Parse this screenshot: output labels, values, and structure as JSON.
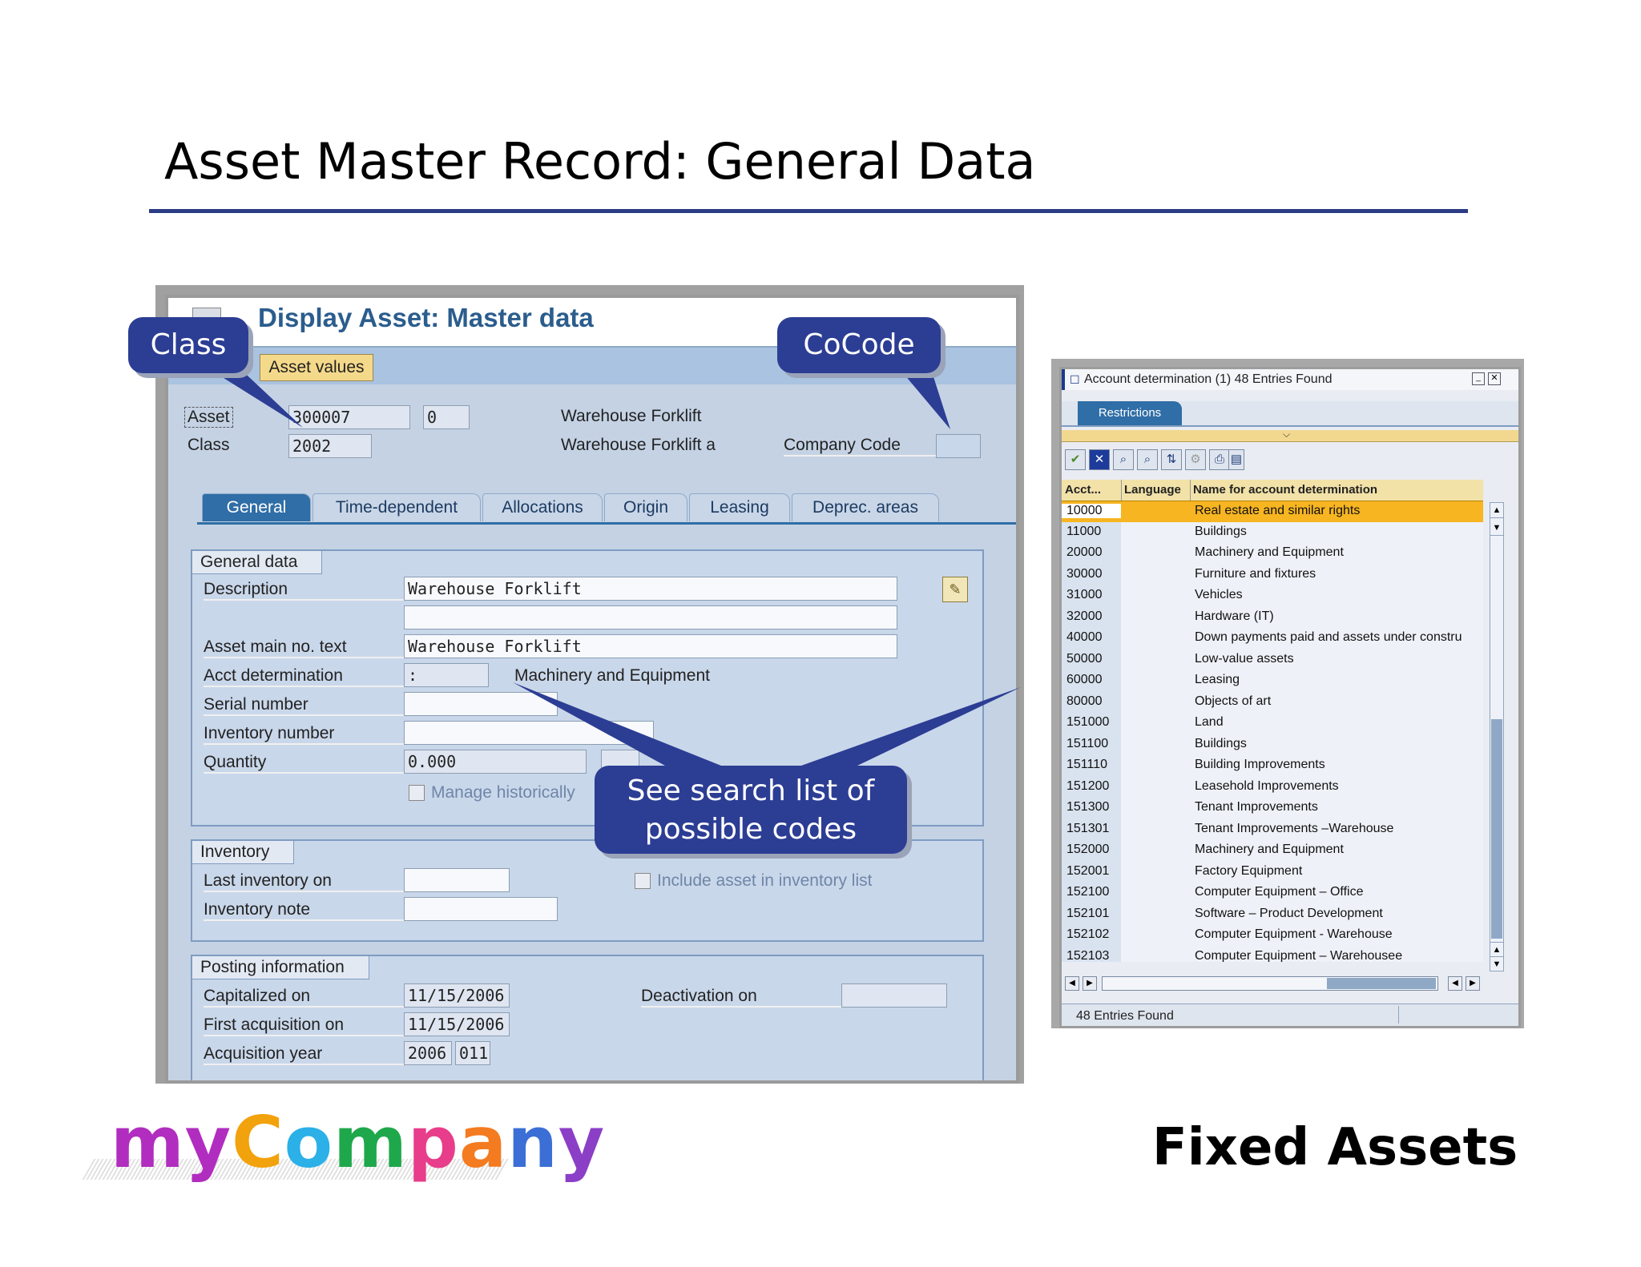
{
  "slide": {
    "title": "Asset Master Record: General Data",
    "footer": "Fixed Assets",
    "logo": {
      "part1": "my",
      "part2": "Company"
    }
  },
  "sap": {
    "title": "Display Asset:  Master data",
    "asset_values_button": "Asset values",
    "header": {
      "asset_label": "Asset",
      "asset_value": "300007",
      "asset_sub": "0",
      "asset_desc": "Warehouse Forklift",
      "class_label": "Class",
      "class_value": "2002",
      "class_desc": "Warehouse Forklift a",
      "company_code_label": "Company Code",
      "company_code_value": ""
    },
    "tabs": [
      "General",
      "Time-dependent",
      "Allocations",
      "Origin",
      "Leasing",
      "Deprec. areas"
    ],
    "general_data": {
      "title": "General data",
      "description_label": "Description",
      "description_value": "Warehouse Forklift",
      "description_value2": "",
      "main_text_label": "Asset main no. text",
      "main_text_value": "Warehouse Forklift",
      "acct_label": "Acct determination",
      "acct_value": ":",
      "acct_desc": "Machinery and Equipment",
      "serial_label": "Serial number",
      "inventory_number_label": "Inventory number",
      "quantity_label": "Quantity",
      "quantity_value": "0.000",
      "manage_historically": "Manage historically"
    },
    "inventory": {
      "title": "Inventory",
      "last_inventory_label": "Last inventory on",
      "inventory_note_label": "Inventory note",
      "include_in_list": "Include asset in inventory list"
    },
    "posting": {
      "title": "Posting information",
      "capitalized_label": "Capitalized on",
      "capitalized_value": "11/15/2006",
      "first_acq_label": "First acquisition on",
      "first_acq_value": "11/15/2006",
      "acq_year_label": "Acquisition year",
      "acq_year_value": "2006",
      "acq_period_value": "011",
      "deactivation_label": "Deactivation on"
    }
  },
  "callouts": {
    "class": "Class",
    "cocode": "CoCode",
    "search_line1": "See search list of",
    "search_line2": "possible codes"
  },
  "popup": {
    "title": "Account determination (1)  48 Entries Found",
    "restrictions_tab": "Restrictions",
    "columns": [
      "Acct...",
      "Language",
      "Name for account determination"
    ],
    "rows": [
      {
        "acct": "10000",
        "name": "Real estate and similar rights"
      },
      {
        "acct": "11000",
        "name": "Buildings"
      },
      {
        "acct": "20000",
        "name": "Machinery and Equipment"
      },
      {
        "acct": "30000",
        "name": "Furniture and fixtures"
      },
      {
        "acct": "31000",
        "name": "Vehicles"
      },
      {
        "acct": "32000",
        "name": "Hardware (IT)"
      },
      {
        "acct": "40000",
        "name": "Down payments paid and assets under constru"
      },
      {
        "acct": "50000",
        "name": "Low-value assets"
      },
      {
        "acct": "60000",
        "name": "Leasing"
      },
      {
        "acct": "80000",
        "name": "Objects of art"
      },
      {
        "acct": "151000",
        "name": "Land"
      },
      {
        "acct": "151100",
        "name": "Buildings"
      },
      {
        "acct": "151110",
        "name": "Building Improvements"
      },
      {
        "acct": "151200",
        "name": "Leasehold Improvements"
      },
      {
        "acct": "151300",
        "name": "Tenant Improvements"
      },
      {
        "acct": "151301",
        "name": "Tenant Improvements –Warehouse"
      },
      {
        "acct": "152000",
        "name": "Machinery and Equipment"
      },
      {
        "acct": "152001",
        "name": "Factory Equipment"
      },
      {
        "acct": "152100",
        "name": "Computer Equipment – Office"
      },
      {
        "acct": "152101",
        "name": "Software – Product Development"
      },
      {
        "acct": "152102",
        "name": "Computer Equipment - Warehouse"
      },
      {
        "acct": "152103",
        "name": "Computer Equipment – Warehousee"
      }
    ],
    "status": "48 Entries Found"
  },
  "colors": {
    "accent": "#2c3d94",
    "selected_row": "#f7b522",
    "title_rule": "#2b3c85"
  }
}
